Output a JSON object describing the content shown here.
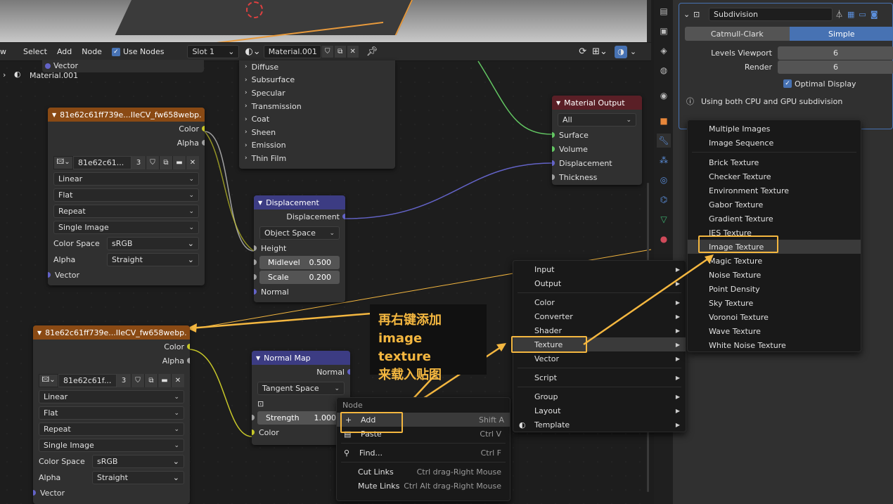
{
  "header": {
    "menus": [
      "w",
      "Select",
      "Add",
      "Node"
    ],
    "use_nodes": "Use Nodes",
    "slot": "Slot 1",
    "material": "Material.001"
  },
  "breadcrumb": {
    "material": "Material.001",
    "vector": "Vector"
  },
  "shader_list": [
    "Diffuse",
    "Subsurface",
    "Specular",
    "Transmission",
    "Coat",
    "Sheen",
    "Emission",
    "Thin Film"
  ],
  "image_node_1": {
    "title": "81e62c61ff739e...IIeCV_fw658webp.",
    "out_color": "Color",
    "out_alpha": "Alpha",
    "image": "81e62c61...",
    "users": "3",
    "interp": "Linear",
    "proj": "Flat",
    "ext": "Repeat",
    "src": "Single Image",
    "cs_label": "Color Space",
    "cs": "sRGB",
    "alpha_label": "Alpha",
    "alpha": "Straight",
    "vector": "Vector"
  },
  "image_node_2": {
    "title": "81e62c61ff739e...IIeCV_fw658webp.",
    "out_color": "Color",
    "out_alpha": "Alpha",
    "image": "81e62c61f...",
    "users": "3",
    "interp": "Linear",
    "proj": "Flat",
    "ext": "Repeat",
    "src": "Single Image",
    "cs_label": "Color Space",
    "cs": "sRGB",
    "alpha_label": "Alpha",
    "alpha": "Straight",
    "vector": "Vector"
  },
  "displacement": {
    "title": "Displacement",
    "out": "Displacement",
    "space": "Object Space",
    "height": "Height",
    "midlevel_label": "Midlevel",
    "midlevel": "0.500",
    "scale_label": "Scale",
    "scale": "0.200",
    "normal": "Normal"
  },
  "normal_map": {
    "title": "Normal Map",
    "out": "Normal",
    "space": "Tangent Space",
    "strength_label": "Strength",
    "strength": "1.000",
    "color": "Color"
  },
  "material_output": {
    "title": "Material Output",
    "target": "All",
    "surface": "Surface",
    "volume": "Volume",
    "displacement": "Displacement",
    "thickness": "Thickness"
  },
  "modifier": {
    "name": "Subdivision",
    "tab_a": "Catmull-Clark",
    "tab_b": "Simple",
    "levels_label": "Levels Viewport",
    "levels": "6",
    "render_label": "Render",
    "render": "6",
    "optimal": "Optimal Display",
    "info": "Using both CPU and GPU subdivision"
  },
  "context_menu": {
    "title": "Node",
    "add": "Add",
    "add_sc": "Shift A",
    "paste": "Paste",
    "paste_sc": "Ctrl V",
    "find": "Find...",
    "find_sc": "Ctrl F",
    "cut": "Cut Links",
    "cut_sc": "Ctrl drag-Right Mouse",
    "mute": "Mute Links",
    "mute_sc": "Ctrl Alt drag-Right Mouse"
  },
  "add_menu": [
    "Input",
    "Output",
    "Color",
    "Converter",
    "Shader",
    "Texture",
    "Vector",
    "Script",
    "Group",
    "Layout",
    "Template"
  ],
  "texture_menu": [
    "Multiple Images",
    "Image Sequence",
    "Brick Texture",
    "Checker Texture",
    "Environment Texture",
    "Gabor Texture",
    "Gradient Texture",
    "IES Texture",
    "Image Texture",
    "Magic Texture",
    "Noise Texture",
    "Point Density",
    "Sky Texture",
    "Voronoi Texture",
    "Wave Texture",
    "White Noise Texture"
  ],
  "annotation": [
    "再右键添加",
    "image texture",
    "来载入贴图"
  ],
  "colors": {
    "accent": "#4772b3",
    "highlight": "#f4b740",
    "texture_header": "#8a4a14",
    "vector_header": "#3c3c83",
    "output_header": "#5a1f26"
  }
}
